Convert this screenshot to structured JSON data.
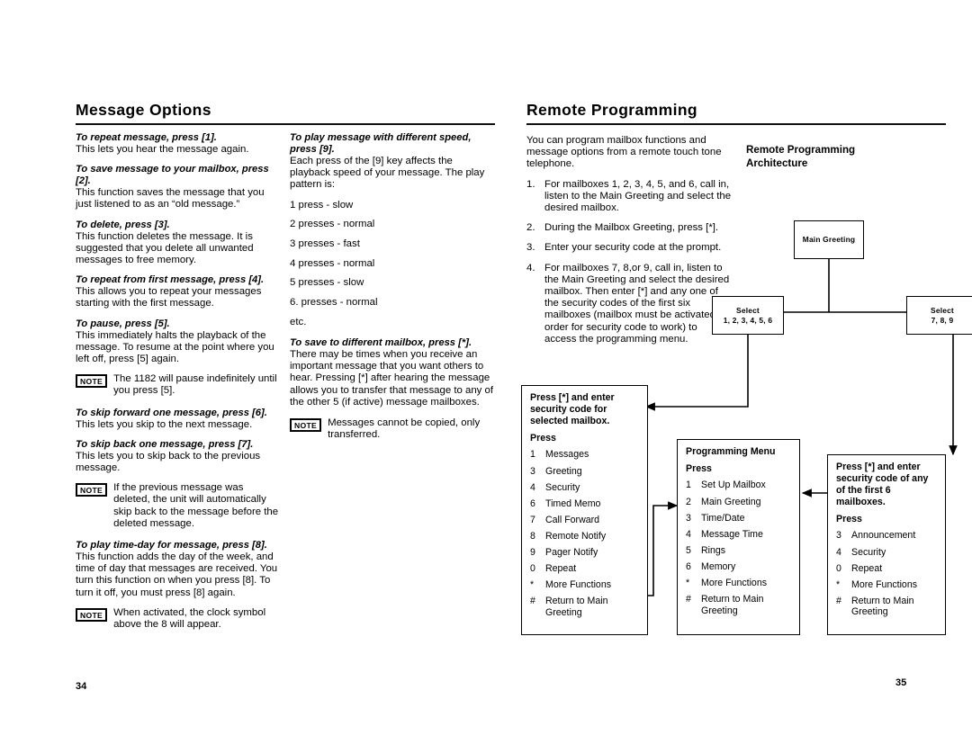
{
  "left_page": {
    "title": "Message Options",
    "page_number": "34",
    "col1": {
      "entries": [
        {
          "lead": "To repeat message, press [1].",
          "body": "This lets you hear the message again."
        },
        {
          "lead": "To save message to your mailbox, press [2].",
          "body": "This function saves the message that you just listened to as an “old message.”"
        },
        {
          "lead": "To delete, press [3].",
          "body": "This function deletes the message. It is suggested that you delete all unwanted messages to free memory."
        },
        {
          "lead": "To repeat from first message, press [4].",
          "body": "This allows you to repeat your messages starting with the first message."
        },
        {
          "lead": "To pause, press [5].",
          "body": "This immediately halts the playback of the message. To resume at the point where you left off, press [5] again."
        }
      ],
      "note1": {
        "tag": "NOTE",
        "text": "The 1182 will pause indefinitely until you press [5]."
      },
      "entries2": [
        {
          "lead": "To skip forward one message, press [6].",
          "body": "This lets you skip to the next message."
        },
        {
          "lead": "To skip back one message, press [7].",
          "body": "This lets you to skip back to the previous message."
        }
      ],
      "note2": {
        "tag": "NOTE",
        "text": "If the previous message was deleted, the unit will automatically skip back to the message before the deleted message."
      },
      "entries3": [
        {
          "lead": "To play time-day for message, press [8].",
          "body": "This function adds the day of the week, and time of day that messages are received. You turn this function on when you press [8]. To turn it off, you must press [8] again."
        }
      ],
      "note3": {
        "tag": "NOTE",
        "text": "When activated, the clock symbol above the 8 will appear."
      }
    },
    "col2": {
      "speed_lead": "To play message with different speed, press [9].",
      "speed_body": "Each press of the [9] key affects the playback speed of your message. The play pattern is:",
      "speed_items": [
        "1 press - slow",
        "2 presses - normal",
        "3 presses - fast",
        "4 presses - normal",
        "5 presses - slow",
        "6. presses - normal",
        "etc."
      ],
      "save_lead": "To save to different mailbox, press [*].",
      "save_body": "There may be times when you receive an important message that you want others to hear. Pressing [*] after hearing the message allows you to transfer that message to any of the other 5 (if active) message mailboxes.",
      "note": {
        "tag": "NOTE",
        "text": "Messages cannot be copied, only transferred."
      }
    }
  },
  "right_page": {
    "title": "Remote Programming",
    "page_number": "35",
    "intro": "You can program mailbox functions and message options from a remote touch tone telephone.",
    "steps": [
      {
        "n": "1.",
        "t": "For mailboxes 1, 2, 3, 4, 5, and 6, call in, listen to the Main Greeting and select the desired mailbox."
      },
      {
        "n": "2.",
        "t": "During the Mailbox Greeting, press [*]."
      },
      {
        "n": "3.",
        "t": "Enter your security code at the prompt."
      },
      {
        "n": "4.",
        "t": "For mailboxes 7, 8,or 9, call in, listen to the Main Greeting and select the desired mailbox. Then enter [*] and any one of the security codes of the first six mailboxes (mailbox must be activated in order for security code to work) to access the programming menu."
      }
    ],
    "arch_title_line1": "Remote Programming",
    "arch_title_line2": "Architecture",
    "diagram": {
      "main_greeting": {
        "label": "Main Greeting"
      },
      "select_left": {
        "line1": "Select",
        "line2": "1, 2, 3, 4, 5, 6"
      },
      "select_right": {
        "line1": "Select",
        "line2": "7, 8, 9"
      },
      "mailbox_menu": {
        "header": "Press [*] and enter security code for selected mailbox.",
        "press_label": "Press",
        "rows": [
          {
            "key": "1",
            "label": "Messages"
          },
          {
            "key": "3",
            "label": "Greeting"
          },
          {
            "key": "4",
            "label": "Security"
          },
          {
            "key": "6",
            "label": "Timed Memo"
          },
          {
            "key": "7",
            "label": "Call Forward"
          },
          {
            "key": "8",
            "label": "Remote Notify"
          },
          {
            "key": "9",
            "label": "Pager Notify"
          },
          {
            "key": "0",
            "label": "Repeat"
          },
          {
            "key": "*",
            "label": "More Functions"
          },
          {
            "key": "#",
            "label": "Return to Main Greeting"
          }
        ]
      },
      "programming_menu": {
        "header": "Programming Menu",
        "press_label": "Press",
        "rows": [
          {
            "key": "1",
            "label": "Set Up Mailbox"
          },
          {
            "key": "2",
            "label": "Main Greeting"
          },
          {
            "key": "3",
            "label": "Time/Date"
          },
          {
            "key": "4",
            "label": "Message Time"
          },
          {
            "key": "5",
            "label": "Rings"
          },
          {
            "key": "6",
            "label": "Memory"
          },
          {
            "key": "*",
            "label": "More Functions"
          },
          {
            "key": "#",
            "label": "Return to Main Greeting"
          }
        ]
      },
      "first6_menu": {
        "header": "Press [*] and enter security code of any of the first 6 mailboxes.",
        "press_label": "Press",
        "rows": [
          {
            "key": "3",
            "label": "Announcement"
          },
          {
            "key": "4",
            "label": "Security"
          },
          {
            "key": "0",
            "label": "Repeat"
          },
          {
            "key": "*",
            "label": "More Functions"
          },
          {
            "key": "#",
            "label": "Return to Main Greeting"
          }
        ]
      }
    }
  }
}
